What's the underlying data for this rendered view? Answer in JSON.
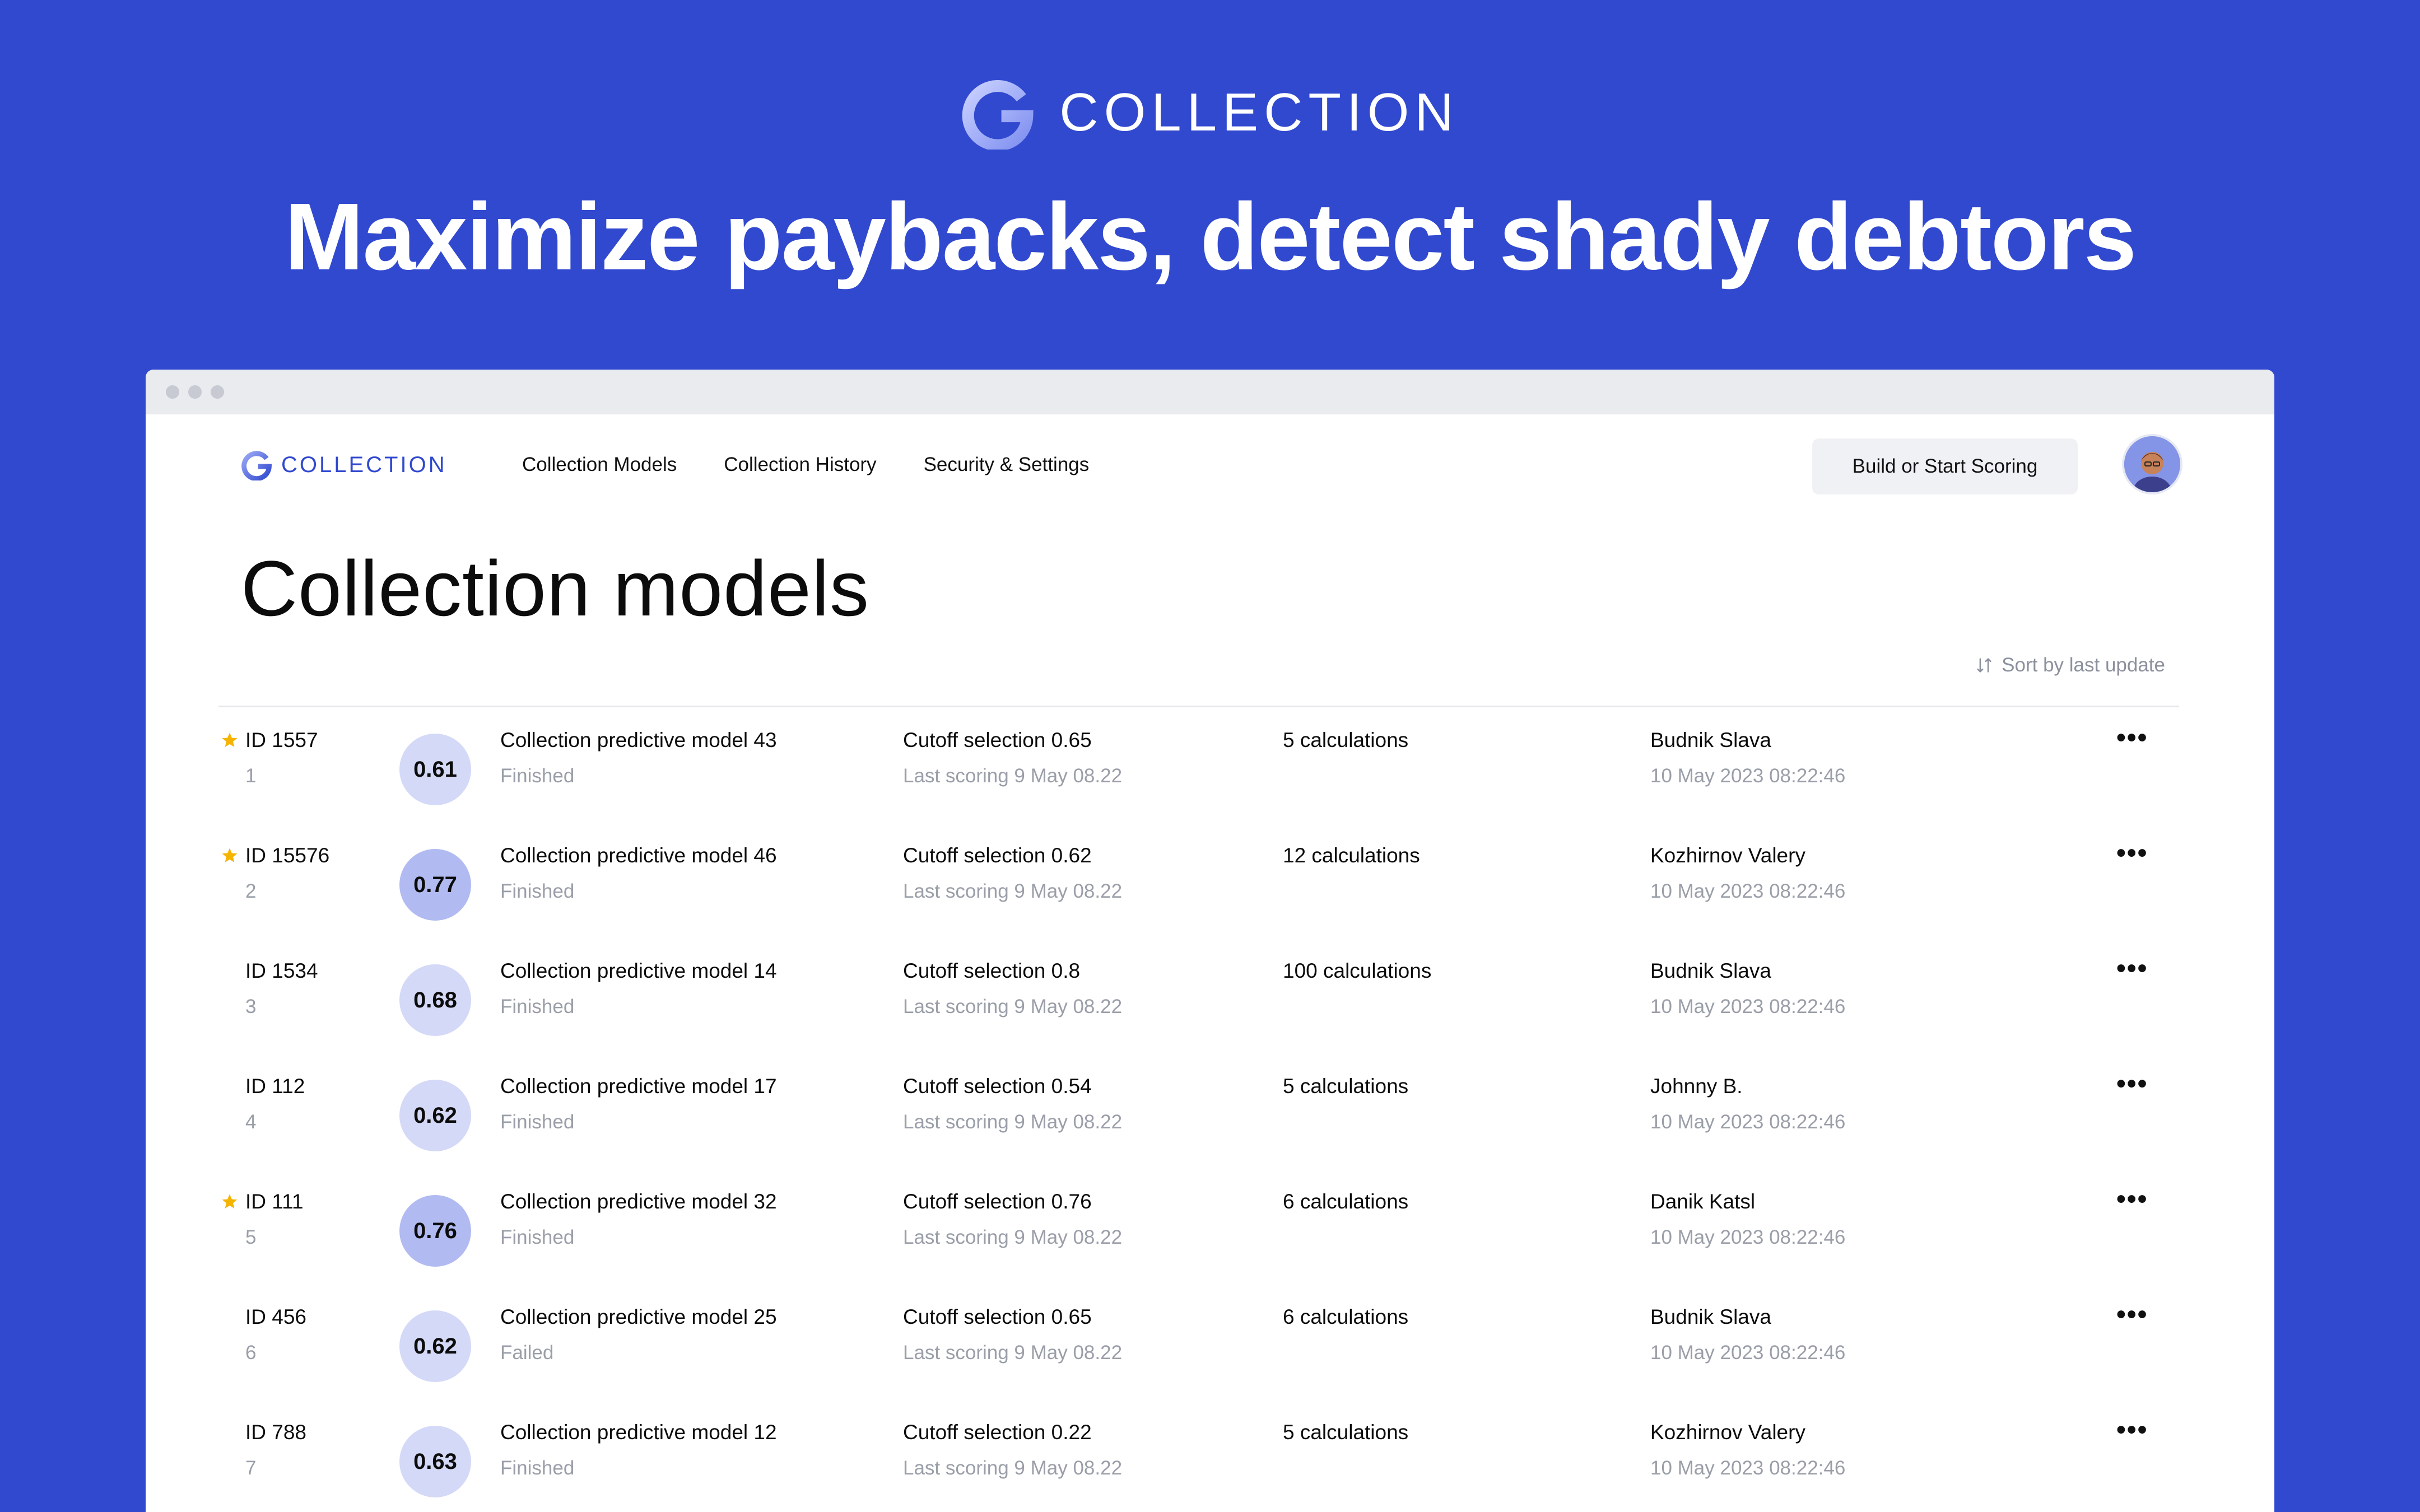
{
  "hero": {
    "brand": "COLLECTION",
    "headline": "Maximize paybacks, detect shady debtors"
  },
  "app": {
    "brand": "COLLECTION",
    "nav": [
      "Collection Models",
      "Collection History",
      "Security & Settings"
    ],
    "cta_label": "Build or Start Scoring",
    "page_title": "Collection models",
    "sort_label": "Sort by last update"
  },
  "colors": {
    "background": "#3149CF",
    "brand": "#3149CF",
    "star": "#F5B400",
    "score_light": "#D4D9F7",
    "score_medium": "#B1BBF1"
  },
  "rows": [
    {
      "starred": true,
      "id": "ID 1557",
      "index": "1",
      "score": "0.61",
      "name": "Collection predictive model 43",
      "status": "Finished",
      "cutoff": "Cutoff selection 0.65",
      "last_scoring": "Last scoring 9 May 08.22",
      "calculations": "5 calculations",
      "user": "Budnik Slava",
      "timestamp": "10 May 2023 08:22:46"
    },
    {
      "starred": true,
      "id": "ID 15576",
      "index": "2",
      "score": "0.77",
      "name": "Collection predictive model 46",
      "status": "Finished",
      "cutoff": "Cutoff selection 0.62",
      "last_scoring": "Last scoring 9 May 08.22",
      "calculations": "12 calculations",
      "user": "Kozhirnov Valery",
      "timestamp": "10 May 2023 08:22:46"
    },
    {
      "starred": false,
      "id": "ID 1534",
      "index": "3",
      "score": "0.68",
      "name": "Collection predictive model 14",
      "status": "Finished",
      "cutoff": "Cutoff selection 0.8",
      "last_scoring": "Last scoring 9 May 08.22",
      "calculations": "100 calculations",
      "user": "Budnik Slava",
      "timestamp": "10 May 2023 08:22:46"
    },
    {
      "starred": false,
      "id": "ID 112",
      "index": "4",
      "score": "0.62",
      "name": "Collection predictive model 17",
      "status": "Finished",
      "cutoff": "Cutoff selection 0.54",
      "last_scoring": "Last scoring 9 May 08.22",
      "calculations": "5 calculations",
      "user": "Johnny B.",
      "timestamp": "10 May 2023 08:22:46"
    },
    {
      "starred": true,
      "id": "ID 111",
      "index": "5",
      "score": "0.76",
      "name": "Collection predictive model 32",
      "status": "Finished",
      "cutoff": "Cutoff selection 0.76",
      "last_scoring": "Last scoring 9 May 08.22",
      "calculations": "6 calculations",
      "user": "Danik Katsl",
      "timestamp": "10 May 2023 08:22:46"
    },
    {
      "starred": false,
      "id": "ID 456",
      "index": "6",
      "score": "0.62",
      "name": "Collection predictive model 25",
      "status": "Failed",
      "cutoff": "Cutoff selection 0.65",
      "last_scoring": "Last scoring 9 May 08.22",
      "calculations": "6 calculations",
      "user": "Budnik Slava",
      "timestamp": "10 May 2023 08:22:46"
    },
    {
      "starred": false,
      "id": "ID 788",
      "index": "7",
      "score": "0.63",
      "name": "Collection predictive model 12",
      "status": "Finished",
      "cutoff": "Cutoff selection 0.22",
      "last_scoring": "Last scoring 9 May 08.22",
      "calculations": "5 calculations",
      "user": "Kozhirnov Valery",
      "timestamp": "10 May 2023 08:22:46"
    }
  ]
}
